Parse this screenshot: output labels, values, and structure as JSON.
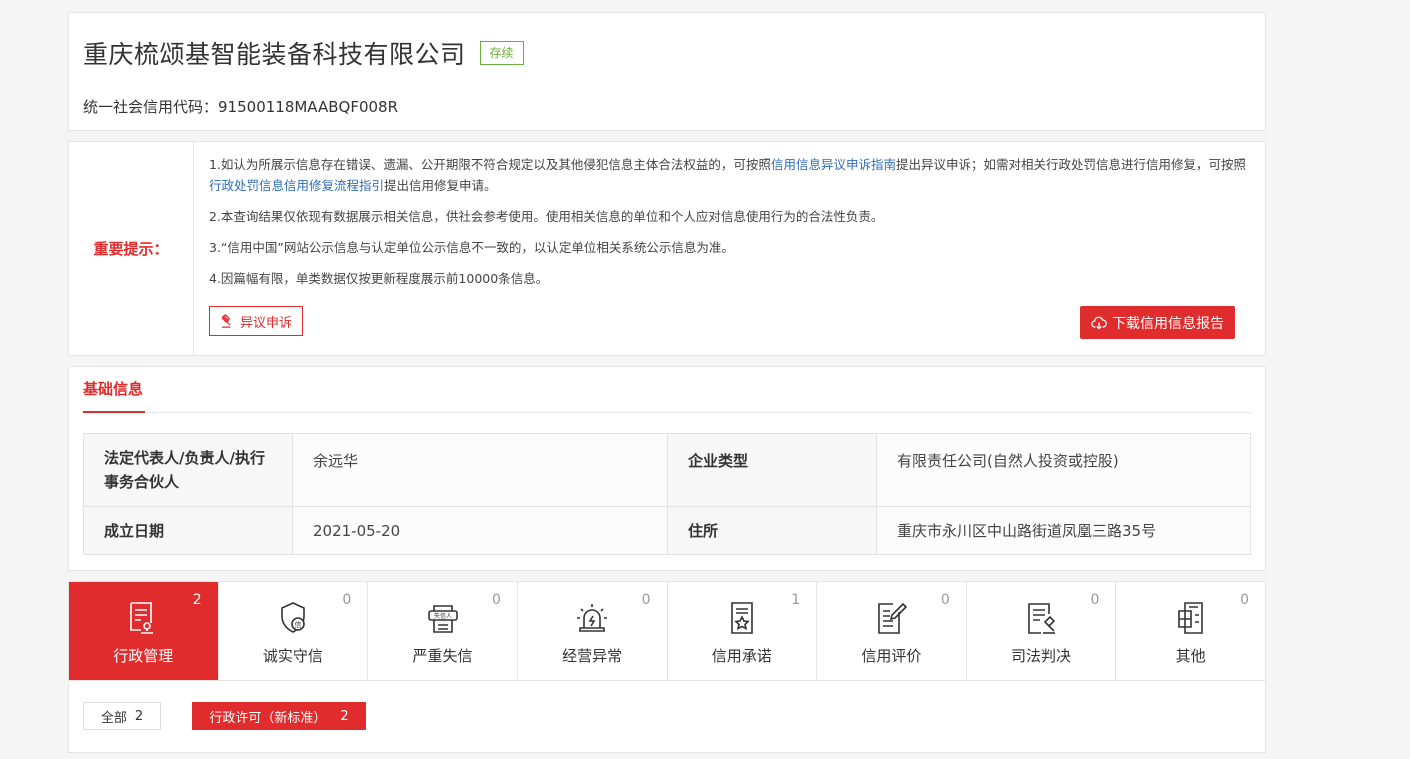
{
  "header": {
    "company_name": "重庆梳颂基智能装备科技有限公司",
    "status": "存续",
    "credit_code_label": "统一社会信用代码：",
    "credit_code": "91500118MAABQF008R"
  },
  "notice": {
    "label": "重要提示：",
    "line1_a": "1.如认为所展示信息存在错误、遗漏、公开期限不符合规定以及其他侵犯信息主体合法权益的，可按照",
    "line1_link1": "信用信息异议申诉指南",
    "line1_b": "提出异议申诉；如需对相关行政处罚信息进行信用修复，可按照",
    "line1_link2": "行政处罚信息信用修复流程指引",
    "line1_c": "提出信用修复申请。",
    "line2": "2.本查询结果仅依现有数据展示相关信息，供社会参考使用。使用相关信息的单位和个人应对信息使用行为的合法性负责。",
    "line3": "3.“信用中国”网站公示信息与认定单位公示信息不一致的，以认定单位相关系统公示信息为准。",
    "line4": "4.因篇幅有限，单类数据仅按更新程度展示前10000条信息。",
    "appeal_label": "异议申诉",
    "download_label": "下载信用信息报告"
  },
  "basic": {
    "tab_label": "基础信息",
    "rows": [
      {
        "k1": "法定代表人/负责人/执行事务合伙人",
        "v1": "余远华",
        "k2": "企业类型",
        "v2": "有限责任公司(自然人投资或控股)"
      },
      {
        "k1": "成立日期",
        "v1": "2021-05-20",
        "k2": "住所",
        "v2": "重庆市永川区中山路街道凤凰三路35号"
      }
    ]
  },
  "categories": [
    {
      "label": "行政管理",
      "count": "2"
    },
    {
      "label": "诚实守信",
      "count": "0"
    },
    {
      "label": "严重失信",
      "count": "0",
      "icon_text": "失信人"
    },
    {
      "label": "经营异常",
      "count": "0"
    },
    {
      "label": "信用承诺",
      "count": "1"
    },
    {
      "label": "信用评价",
      "count": "0"
    },
    {
      "label": "司法判决",
      "count": "0"
    },
    {
      "label": "其他",
      "count": "0"
    }
  ],
  "filters": {
    "all_label": "全部",
    "all_count": "2",
    "admin_label": "行政许可（新标准）",
    "admin_count": "2"
  },
  "colors": {
    "accent": "#e02c2c",
    "status_green": "#6cae3c",
    "link": "#2f6db5"
  }
}
